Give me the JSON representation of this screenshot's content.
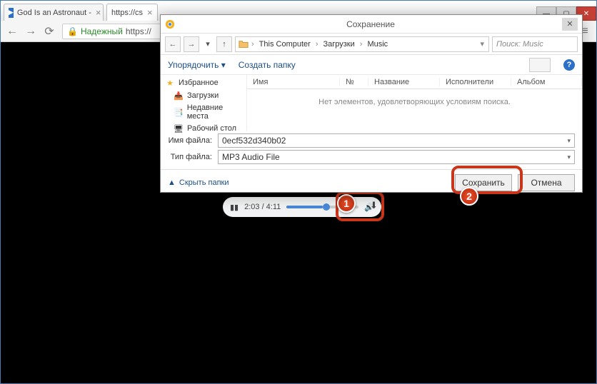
{
  "window_controls": {
    "minimize": "—",
    "maximize": "▢",
    "close": "✕"
  },
  "tabs": [
    {
      "title": "God Is an Astronaut - ",
      "favicon": "▶"
    },
    {
      "title": "https://cs",
      "favicon": ""
    }
  ],
  "address_bar": {
    "secure_label": "Надежный",
    "url": "https://"
  },
  "audio_player": {
    "pause_glyph": "▮▮",
    "time": "2:03 / 4:11",
    "volume_glyph": "🔊",
    "download_glyph": "⬇"
  },
  "markers": {
    "one": "1",
    "two": "2"
  },
  "save_dialog": {
    "title": "Сохранение",
    "close_glyph": "✕",
    "nav": {
      "back": "←",
      "forward": "→",
      "up": "↑",
      "refresh_dd": "▾"
    },
    "breadcrumb": {
      "items": [
        "This Computer",
        "Загрузки",
        "Music"
      ],
      "sep": "›",
      "dd": "▾"
    },
    "search": {
      "placeholder": "Поиск: Music"
    },
    "toolbar": {
      "organize": "Упорядочить ▾",
      "new_folder": "Создать папку",
      "help": "?"
    },
    "sidebar": {
      "favorites": {
        "label": "Избранное",
        "icon": "★"
      },
      "items": [
        {
          "label": "Загрузки",
          "icon": "📥"
        },
        {
          "label": "Недавние места",
          "icon": "📑"
        },
        {
          "label": "Рабочий стол",
          "icon": "🖥"
        }
      ]
    },
    "columns": [
      "Имя",
      "№",
      "Название",
      "Исполнители",
      "Альбом"
    ],
    "empty_message": "Нет элементов, удовлетворяющих условиям поиска.",
    "fields": {
      "filename_label": "Имя файла:",
      "filename_value": "0ecf532d340b02",
      "filetype_label": "Тип файла:",
      "filetype_value": "MP3 Audio File"
    },
    "footer": {
      "hide_folders": "Скрыть папки",
      "hide_folders_icon": "▲",
      "save": "Сохранить",
      "cancel": "Отмена"
    }
  }
}
